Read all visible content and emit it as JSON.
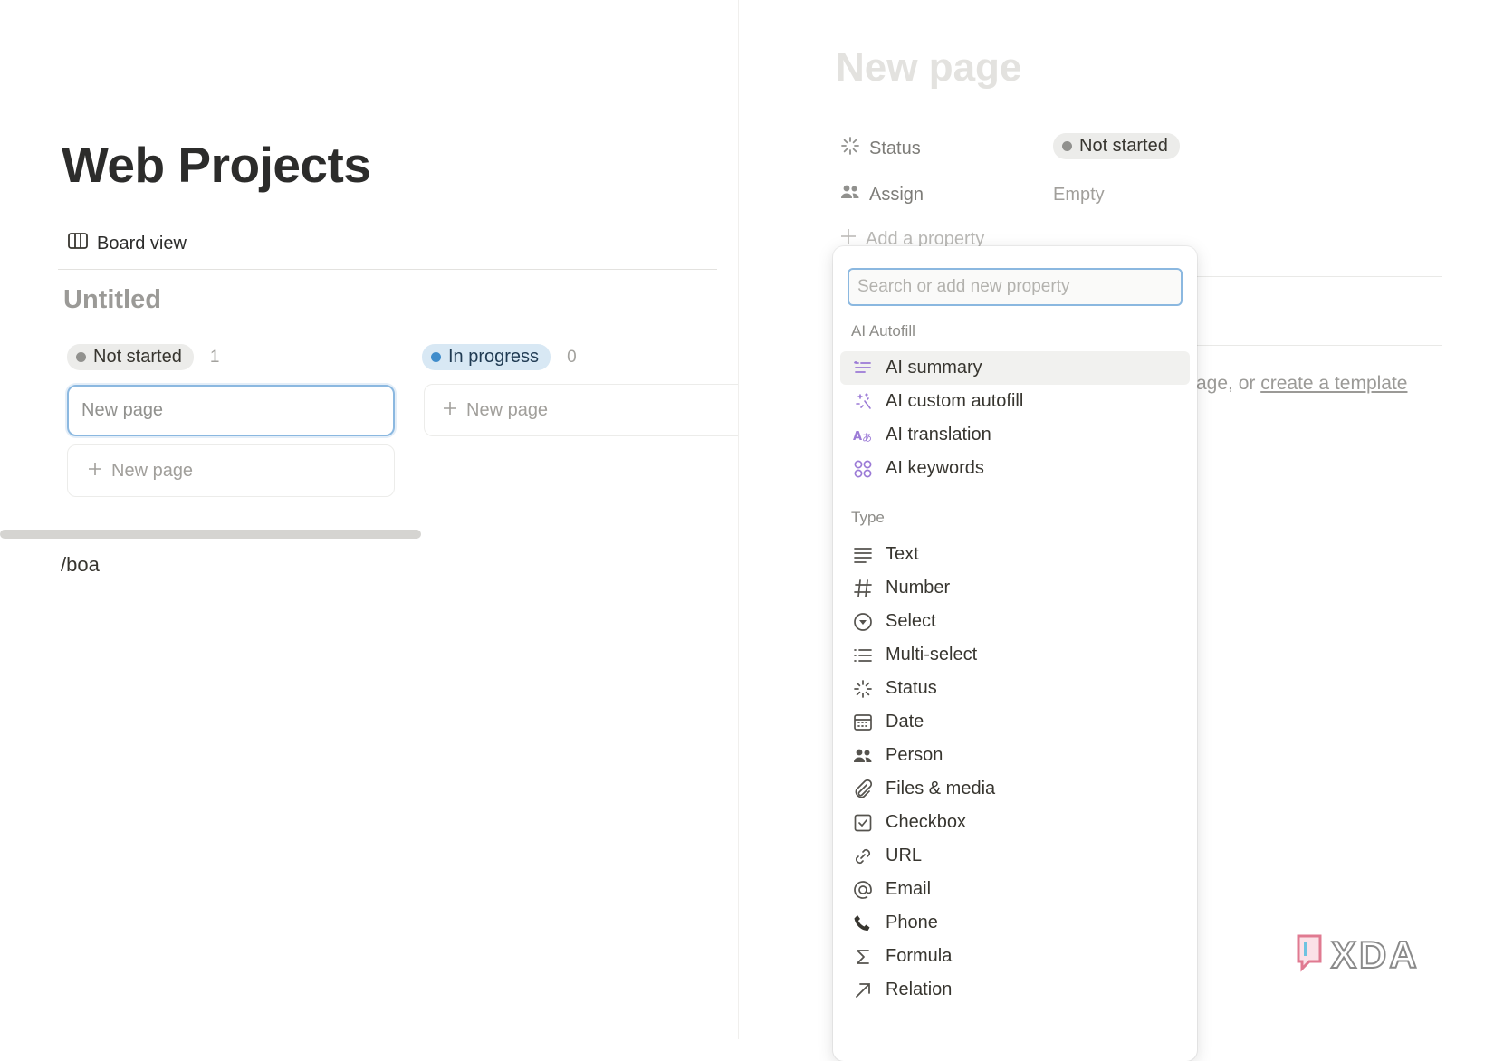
{
  "board": {
    "title": "Web Projects",
    "view_tab": "Board view",
    "name": "Untitled",
    "groups": [
      {
        "label": "Not started",
        "count": "1"
      },
      {
        "label": "In progress",
        "count": "0"
      }
    ],
    "card_editing_placeholder": "New page",
    "new_page_label": "New page",
    "slash_text": "/boa"
  },
  "panel": {
    "title": "New page",
    "properties": [
      {
        "label": "Status",
        "value": "Not started"
      },
      {
        "label": "Assign",
        "value": "Empty"
      }
    ],
    "add_property": "Add a property",
    "hint_prefix": "age, or ",
    "hint_link": "create a template"
  },
  "menu": {
    "search_placeholder": "Search or add new property",
    "ai_section": "AI Autofill",
    "ai_items": [
      {
        "label": "AI summary",
        "icon": "ai-summary-icon"
      },
      {
        "label": "AI custom autofill",
        "icon": "sparkle-icon"
      },
      {
        "label": "AI translation",
        "icon": "translate-icon"
      },
      {
        "label": "AI keywords",
        "icon": "keywords-icon"
      }
    ],
    "type_section": "Type",
    "type_items": [
      {
        "label": "Text",
        "icon": "text-lines-icon"
      },
      {
        "label": "Number",
        "icon": "hash-icon"
      },
      {
        "label": "Select",
        "icon": "select-circle-icon"
      },
      {
        "label": "Multi-select",
        "icon": "list-icon"
      },
      {
        "label": "Status",
        "icon": "status-spinner-icon"
      },
      {
        "label": "Date",
        "icon": "calendar-icon"
      },
      {
        "label": "Person",
        "icon": "people-icon"
      },
      {
        "label": "Files & media",
        "icon": "paperclip-icon"
      },
      {
        "label": "Checkbox",
        "icon": "checkbox-icon"
      },
      {
        "label": "URL",
        "icon": "link-icon"
      },
      {
        "label": "Email",
        "icon": "at-sign-icon"
      },
      {
        "label": "Phone",
        "icon": "phone-icon"
      },
      {
        "label": "Formula",
        "icon": "sigma-icon"
      },
      {
        "label": "Relation",
        "icon": "arrow-up-right-icon"
      }
    ]
  },
  "watermark": {
    "text": "XDA"
  },
  "colors": {
    "accent_blue": "#8bb8e0",
    "status_grey": "#91918e",
    "status_blue": "#3f8ccb",
    "ai_purple": "#9b7ad6"
  }
}
